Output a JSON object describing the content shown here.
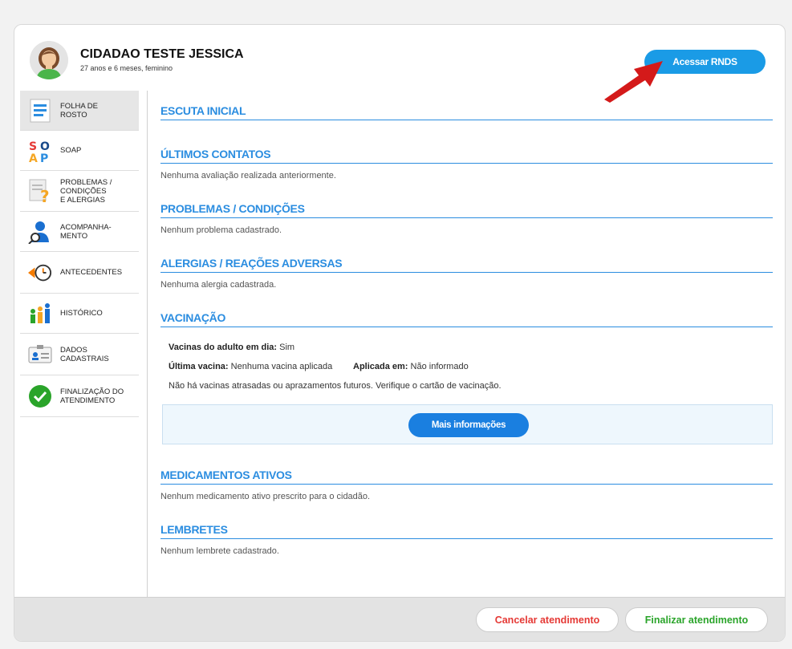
{
  "patient": {
    "name": "CIDADAO TESTE JESSICA",
    "info": "27 anos e 6 meses, feminino"
  },
  "header": {
    "rnds_button": "Acessar RNDS"
  },
  "sidebar": {
    "items": [
      {
        "label": "FOLHA DE\nROSTO",
        "icon": "document-icon"
      },
      {
        "label": "SOAP",
        "icon": "soap-icon"
      },
      {
        "label": "PROBLEMAS /\nCONDIÇÕES\nE ALERGIAS",
        "icon": "problems-icon"
      },
      {
        "label": "ACOMPANHA-\nMENTO",
        "icon": "person-search-icon"
      },
      {
        "label": "ANTECEDENTES",
        "icon": "clock-back-icon"
      },
      {
        "label": "HISTÓRICO",
        "icon": "family-icon"
      },
      {
        "label": "DADOS\nCADASTRAIS",
        "icon": "id-card-icon"
      },
      {
        "label": "FINALIZAÇÃO DO\nATENDIMENTO",
        "icon": "check-icon"
      }
    ]
  },
  "sections": {
    "escuta": {
      "title": "ESCUTA INICIAL"
    },
    "contatos": {
      "title": "ÚLTIMOS CONTATOS",
      "text": "Nenhuma avaliação realizada anteriormente."
    },
    "problemas": {
      "title": "PROBLEMAS / CONDIÇÕES",
      "text": "Nenhum problema cadastrado."
    },
    "alergias": {
      "title": "ALERGIAS / REAÇÕES ADVERSAS",
      "text": "Nenhuma alergia cadastrada."
    },
    "vacinacao": {
      "title": "VACINAÇÃO",
      "adulto_label": "Vacinas do adulto em dia:",
      "adulto_value": "Sim",
      "ultima_label": "Última vacina:",
      "ultima_value": "Nenhuma vacina aplicada",
      "aplicada_label": "Aplicada em:",
      "aplicada_value": "Não informado",
      "note": "Não há vacinas atrasadas ou aprazamentos futuros. Verifique o cartão de vacinação.",
      "more_button": "Mais informações"
    },
    "medicamentos": {
      "title": "MEDICAMENTOS ATIVOS",
      "text": "Nenhum medicamento ativo prescrito para o cidadão."
    },
    "lembretes": {
      "title": "LEMBRETES",
      "text": "Nenhum lembrete cadastrado."
    }
  },
  "footer": {
    "cancel_button": "Cancelar atendimento",
    "finish_button": "Finalizar atendimento"
  },
  "colors": {
    "accent": "#2b8de0",
    "primary_button": "#1a9be6",
    "cancel": "#e53935",
    "finish": "#2aa42a",
    "arrow": "#d41a1a"
  }
}
